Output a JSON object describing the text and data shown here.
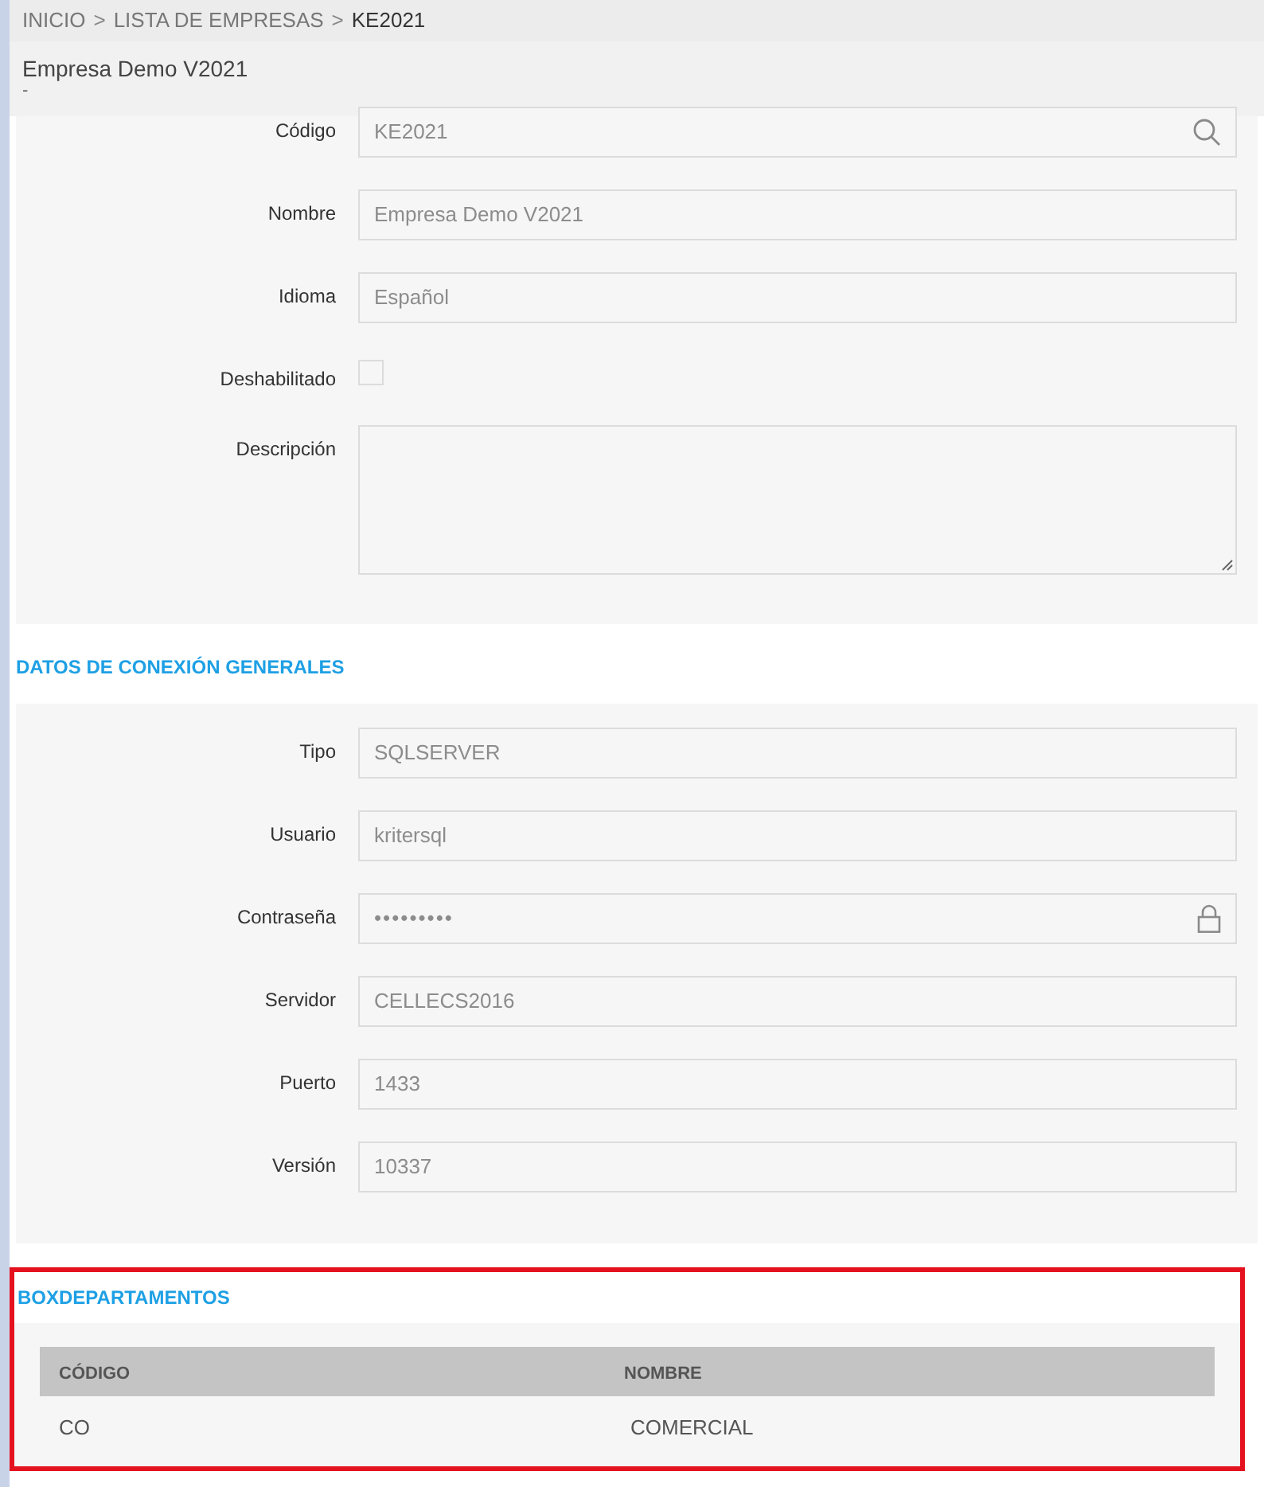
{
  "breadcrumb": [
    {
      "label": "INICIO",
      "current": false
    },
    {
      "label": "LISTA DE EMPRESAS",
      "current": false
    },
    {
      "label": "KE2021",
      "current": true
    }
  ],
  "breadcrumb_separator": ">",
  "header": {
    "title": "Empresa Demo V2021",
    "subtitle": "-"
  },
  "general_fields": [
    {
      "label": "Código",
      "kind": "search",
      "value": "KE2021"
    },
    {
      "label": "Nombre",
      "kind": "text",
      "value": "Empresa Demo V2021"
    },
    {
      "label": "Idioma",
      "kind": "text",
      "value": "Español"
    },
    {
      "label": "Deshabilitado",
      "kind": "checkbox",
      "checked": false
    },
    {
      "label": "Descripción",
      "kind": "textarea"
    }
  ],
  "connection_section": {
    "title": "DATOS DE CONEXIÓN GENERALES",
    "fields": [
      {
        "label": "Tipo",
        "kind": "text",
        "value": "SQLSERVER"
      },
      {
        "label": "Usuario",
        "kind": "text",
        "value": "kritersql"
      },
      {
        "label": "Contraseña",
        "kind": "password",
        "value": "•••••••••"
      },
      {
        "label": "Servidor",
        "kind": "text",
        "value": "CELLECS2016"
      },
      {
        "label": "Puerto",
        "kind": "text",
        "value": "1433"
      },
      {
        "label": "Versión",
        "kind": "text",
        "value": "10337"
      }
    ]
  },
  "departments_section": {
    "title": "BOXDEPARTAMENTOS",
    "table": {
      "columns": [
        "CÓDIGO",
        "NOMBRE"
      ],
      "rows": [
        [
          "CO",
          "COMERCIAL"
        ]
      ]
    }
  }
}
